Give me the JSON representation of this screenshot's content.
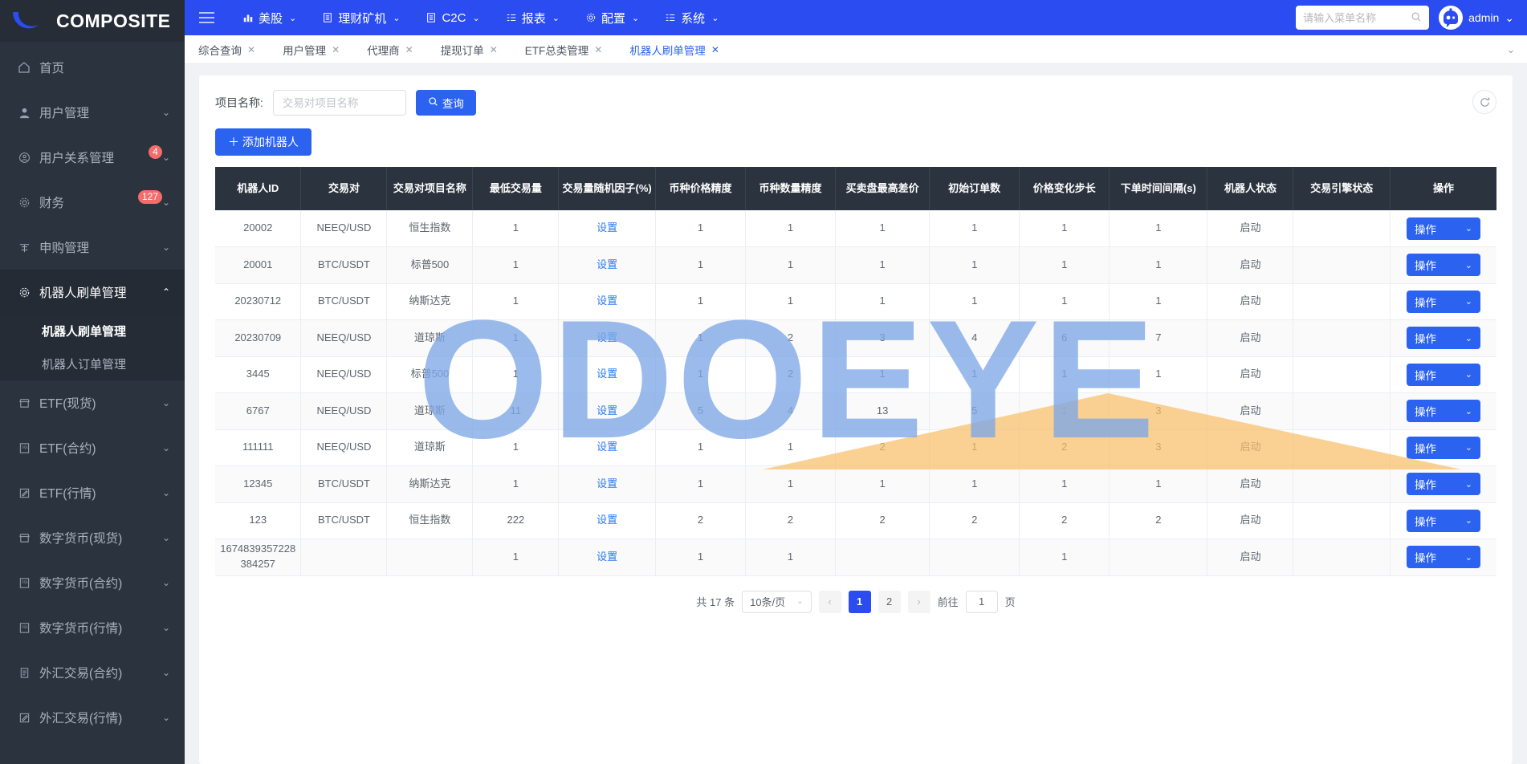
{
  "brand": {
    "name": "COMPOSITE",
    "logo_icon": "crescent-logo-icon"
  },
  "sidebar": {
    "items": [
      {
        "label": "首页",
        "icon": "home-icon",
        "badge": "",
        "chevron": "",
        "active": false
      },
      {
        "label": "用户管理",
        "icon": "user-icon",
        "badge": "",
        "chevron": "⌄",
        "active": false
      },
      {
        "label": "用户关系管理",
        "icon": "user-circle-icon",
        "badge": "4",
        "chevron": "⌄",
        "active": false
      },
      {
        "label": "财务",
        "icon": "gear-icon",
        "badge": "127",
        "chevron": "⌄",
        "active": false
      },
      {
        "label": "申购管理",
        "icon": "cart-icon",
        "badge": "",
        "chevron": "⌄",
        "active": false
      },
      {
        "label": "机器人刷单管理",
        "icon": "gear-icon",
        "badge": "",
        "chevron": "⌃",
        "active": true
      },
      {
        "label": "ETF(现货)",
        "icon": "shop-icon",
        "badge": "",
        "chevron": "⌄",
        "active": false
      },
      {
        "label": "ETF(合约)",
        "icon": "sql-icon",
        "badge": "",
        "chevron": "⌄",
        "active": false
      },
      {
        "label": "ETF(行情)",
        "icon": "edit-icon",
        "badge": "",
        "chevron": "⌄",
        "active": false
      },
      {
        "label": "数字货币(现货)",
        "icon": "shop-icon",
        "badge": "",
        "chevron": "⌄",
        "active": false
      },
      {
        "label": "数字货币(合约)",
        "icon": "sql-icon",
        "badge": "",
        "chevron": "⌄",
        "active": false
      },
      {
        "label": "数字货币(行情)",
        "icon": "sql-icon",
        "badge": "",
        "chevron": "⌄",
        "active": false
      },
      {
        "label": "外汇交易(合约)",
        "icon": "doc-icon",
        "badge": "",
        "chevron": "⌄",
        "active": false
      },
      {
        "label": "外汇交易(行情)",
        "icon": "edit-icon",
        "badge": "",
        "chevron": "⌄",
        "active": false
      }
    ],
    "subitems": [
      {
        "label": "机器人刷单管理",
        "active": true
      },
      {
        "label": "机器人订单管理",
        "active": false
      }
    ]
  },
  "topbar": {
    "menu": [
      {
        "label": "美股",
        "icon": "bar-chart-icon",
        "chevron": "⌄"
      },
      {
        "label": "理财矿机",
        "icon": "list-icon",
        "chevron": "⌄"
      },
      {
        "label": "C2C",
        "icon": "list-icon",
        "chevron": "⌄"
      },
      {
        "label": "报表",
        "icon": "table-icon",
        "chevron": "⌄"
      },
      {
        "label": "配置",
        "icon": "gear-icon",
        "chevron": "⌄"
      },
      {
        "label": "系统",
        "icon": "table-icon",
        "chevron": "⌄"
      }
    ],
    "search_placeholder": "请输入菜单名称",
    "search_value": "",
    "user_name": "admin",
    "user_chevron": "⌄"
  },
  "tabs": [
    {
      "label": "综合查询",
      "active": false
    },
    {
      "label": "用户管理",
      "active": false
    },
    {
      "label": "代理商",
      "active": false
    },
    {
      "label": "提现订单",
      "active": false
    },
    {
      "label": "ETF总类管理",
      "active": false
    },
    {
      "label": "机器人刷单管理",
      "active": true
    }
  ],
  "filter": {
    "label": "项目名称:",
    "input_placeholder": "交易对项目名称",
    "input_value": "",
    "query_button": "查询",
    "refresh_icon": "refresh-icon"
  },
  "toolbar": {
    "add_button": "＋ 添加机器人"
  },
  "table": {
    "columns": [
      "机器人ID",
      "交易对",
      "交易对项目名称",
      "最低交易量",
      "交易量随机因子(%)",
      "币种价格精度",
      "币种数量精度",
      "买卖盘最高差价",
      "初始订单数",
      "价格变化步长",
      "下单时间间隔(s)",
      "机器人状态",
      "交易引擎状态",
      "操作"
    ],
    "setting_link": "设置",
    "op_button": "操作",
    "rows": [
      {
        "id": "20002",
        "pair": "NEEQ/USD",
        "project": "恒生指数",
        "min_vol": "1",
        "factor": "设置",
        "price_prec": "1",
        "qty_prec": "1",
        "max_spread": "1",
        "init_orders": "1",
        "price_step": "1",
        "interval": "1",
        "robot_status": "启动",
        "engine_status": ""
      },
      {
        "id": "20001",
        "pair": "BTC/USDT",
        "project": "标普500",
        "min_vol": "1",
        "factor": "设置",
        "price_prec": "1",
        "qty_prec": "1",
        "max_spread": "1",
        "init_orders": "1",
        "price_step": "1",
        "interval": "1",
        "robot_status": "启动",
        "engine_status": ""
      },
      {
        "id": "20230712",
        "pair": "BTC/USDT",
        "project": "纳斯达克",
        "min_vol": "1",
        "factor": "设置",
        "price_prec": "1",
        "qty_prec": "1",
        "max_spread": "1",
        "init_orders": "1",
        "price_step": "1",
        "interval": "1",
        "robot_status": "启动",
        "engine_status": ""
      },
      {
        "id": "20230709",
        "pair": "NEEQ/USD",
        "project": "道琼斯",
        "min_vol": "1",
        "factor": "设置",
        "price_prec": "1",
        "qty_prec": "2",
        "max_spread": "3",
        "init_orders": "4",
        "price_step": "6",
        "interval": "7",
        "robot_status": "启动",
        "engine_status": ""
      },
      {
        "id": "3445",
        "pair": "NEEQ/USD",
        "project": "标普500",
        "min_vol": "1",
        "factor": "设置",
        "price_prec": "1",
        "qty_prec": "2",
        "max_spread": "1",
        "init_orders": "1",
        "price_step": "1",
        "interval": "1",
        "robot_status": "启动",
        "engine_status": ""
      },
      {
        "id": "6767",
        "pair": "NEEQ/USD",
        "project": "道琼斯",
        "min_vol": "11",
        "factor": "设置",
        "price_prec": "5",
        "qty_prec": "4",
        "max_spread": "13",
        "init_orders": "5",
        "price_step": "1",
        "interval": "3",
        "robot_status": "启动",
        "engine_status": ""
      },
      {
        "id": "111111",
        "pair": "NEEQ/USD",
        "project": "道琼斯",
        "min_vol": "1",
        "factor": "设置",
        "price_prec": "1",
        "qty_prec": "1",
        "max_spread": "2",
        "init_orders": "1",
        "price_step": "2",
        "interval": "3",
        "robot_status": "启动",
        "engine_status": ""
      },
      {
        "id": "12345",
        "pair": "BTC/USDT",
        "project": "纳斯达克",
        "min_vol": "1",
        "factor": "设置",
        "price_prec": "1",
        "qty_prec": "1",
        "max_spread": "1",
        "init_orders": "1",
        "price_step": "1",
        "interval": "1",
        "robot_status": "启动",
        "engine_status": ""
      },
      {
        "id": "123",
        "pair": "BTC/USDT",
        "project": "恒生指数",
        "min_vol": "222",
        "factor": "设置",
        "price_prec": "2",
        "qty_prec": "2",
        "max_spread": "2",
        "init_orders": "2",
        "price_step": "2",
        "interval": "2",
        "robot_status": "启动",
        "engine_status": ""
      },
      {
        "id": "1674839357228384257",
        "pair": "",
        "project": "",
        "min_vol": "1",
        "factor": "设置",
        "price_prec": "1",
        "qty_prec": "1",
        "max_spread": "",
        "init_orders": "",
        "price_step": "1",
        "interval": "",
        "robot_status": "启动",
        "engine_status": ""
      }
    ]
  },
  "pagination": {
    "total_text": "共 17 条",
    "page_size": "10条/页",
    "prev": "‹",
    "next": "›",
    "pages": [
      "1",
      "2"
    ],
    "current_page": "1",
    "jump_label": "前往",
    "jump_value": "1",
    "jump_suffix": "页"
  },
  "watermark": {
    "text": "ODOEYE",
    "color": "#7fa8e8"
  },
  "colors": {
    "primary": "#2b63f0",
    "topbar": "#2b4cf0",
    "sidebar": "#2b333e",
    "header": "#2b333e",
    "badge": "#f56c6c",
    "link": "#2b7af0"
  }
}
